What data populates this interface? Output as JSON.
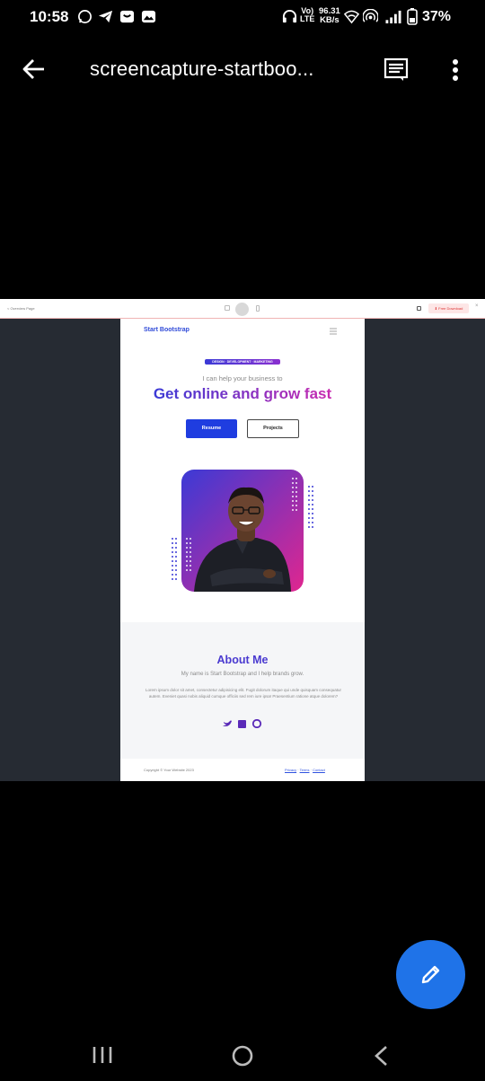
{
  "status_bar": {
    "time": "10:58",
    "lte_top": "Vo)",
    "lte_bottom": "LTE",
    "speed_top": "96.31",
    "speed_bottom": "KB/s",
    "battery": "37%",
    "icons": [
      "whatsapp-icon",
      "telegram-icon",
      "bag-icon",
      "photo-icon",
      "headset-icon",
      "wifi-icon",
      "hotspot-icon",
      "signal-icon",
      "battery-icon"
    ]
  },
  "app_bar": {
    "title": "screencapture-startboo...",
    "icons": [
      "back-arrow-icon",
      "text-view-icon",
      "more-vert-icon"
    ]
  },
  "browser_bar": {
    "back_label": "< Overview Page",
    "download_label": "⬇ Free Download"
  },
  "site": {
    "brand": "Start Bootstrap",
    "badge": "DESIGN · DEVELOPMENT · MARKETING",
    "subheading": "I can help your business to",
    "headline": "Get online and grow fast",
    "btn_resume": "Resume",
    "btn_projects": "Projects",
    "about_title": "About Me",
    "about_sub": "My name is Start Bootstrap and I help brands grow.",
    "about_body": "Lorem ipsum dolor sit amet, consectetur adipisicing elit. Fugit dolorum itaque qui unde quisquam consequatur autem. Eveniet quasi nobis aliquid cumque officiis sed rem iure ipsa! Praesentium ratione atque dolorem?",
    "footer_copy": "Copyright © Your Website 2023",
    "footer_links": [
      "Privacy",
      "Terms",
      "Contact"
    ]
  },
  "colors": {
    "accent_blue": "#1f3de0",
    "headline_gradient": [
      "#3b3ad6",
      "#c92bb0"
    ],
    "fab": "#1f73e8",
    "viewer_bg": "#262b33"
  }
}
